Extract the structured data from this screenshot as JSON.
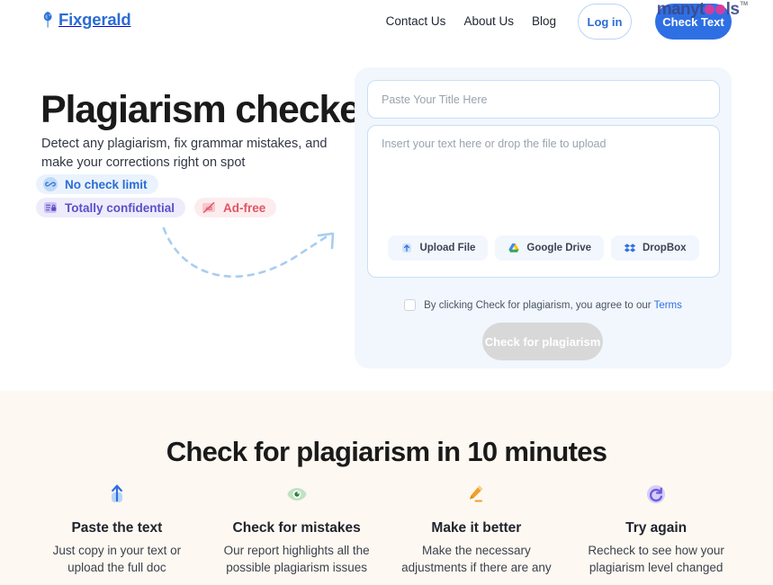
{
  "brand": {
    "name": "Fixgerald",
    "logo_icon": "feather-bird-icon",
    "color": "#2b6cd4"
  },
  "watermark": {
    "text_before": "manyt",
    "text_after": "ls",
    "tm": "TM",
    "dot_color": "#e0399b",
    "text_color": "#3b4a8c"
  },
  "header": {
    "nav": [
      {
        "label": "Contact Us",
        "name": "nav-contact-us"
      },
      {
        "label": "About Us",
        "name": "nav-about-us"
      },
      {
        "label": "Blog",
        "name": "nav-blog"
      }
    ],
    "login_label": "Log in",
    "cta_label": "Check Text",
    "cta_color": "#2f6fe4"
  },
  "hero": {
    "title": "Plagiarism checker",
    "subtitle": "Detect any plagiarism, fix grammar mistakes, and make your corrections right on spot",
    "pills": [
      {
        "label": "No check limit",
        "icon": "infinity-icon",
        "style": "pill-blue",
        "color": "#2b6cd4",
        "bg": "#eaf3fd"
      },
      {
        "label": "Totally confidential",
        "icon": "lock-document-icon",
        "style": "pill-purple",
        "color": "#5b4fc7",
        "bg": "#eeecfb"
      },
      {
        "label": "Ad-free",
        "icon": "no-ads-icon",
        "style": "pill-red",
        "color": "#e05563",
        "bg": "#fdecee"
      }
    ],
    "arrow_decoration": "dashed-curved-arrow-icon"
  },
  "checker_card": {
    "title_input": {
      "value": "",
      "placeholder": "Paste Your Title Here"
    },
    "text_input": {
      "value": "",
      "placeholder": "Insert your text here or drop the file to upload"
    },
    "upload_buttons": [
      {
        "label": "Upload File",
        "icon": "upload-arrow-icon"
      },
      {
        "label": "Google Drive",
        "icon": "google-drive-icon"
      },
      {
        "label": "DropBox",
        "icon": "dropbox-icon"
      }
    ],
    "terms": {
      "checked": false,
      "text": "By clicking Check for plagiarism, you agree to our ",
      "link_label": "Terms"
    },
    "submit_label": "Check for plagiarism",
    "submit_disabled": true
  },
  "features": {
    "heading": "Check for plagiarism in 10 minutes",
    "background": "#fdf8f1",
    "items": [
      {
        "icon": "upload-arrow-icon",
        "icon_color": "#2f6fe4",
        "title": "Paste the text",
        "desc": "Just copy in your text or upload the full doc"
      },
      {
        "icon": "eye-icon",
        "icon_color": "#3f9e52",
        "title": "Check for mistakes",
        "desc": "Our report highlights all the possible plagiarism issues"
      },
      {
        "icon": "pencil-icon",
        "icon_color": "#ed9b23",
        "title": "Make it better",
        "desc": "Make the necessary adjustments if there are any"
      },
      {
        "icon": "refresh-icon",
        "icon_color": "#6d57e0",
        "title": "Try again",
        "desc": "Recheck to see how your plagiarism level changed"
      }
    ]
  }
}
